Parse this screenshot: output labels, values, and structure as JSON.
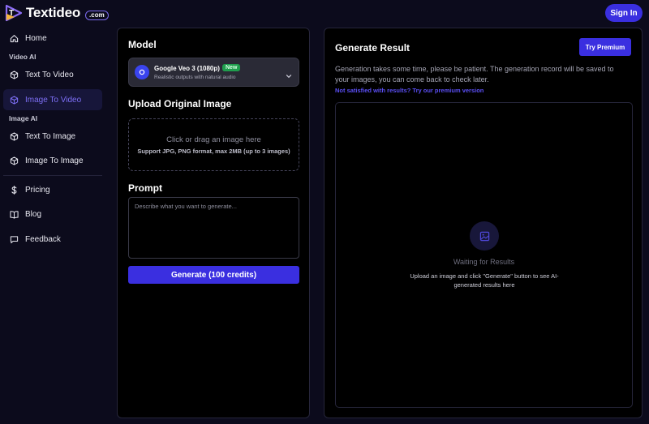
{
  "brand": {
    "name": "Textideo",
    "suffix": ".com"
  },
  "header": {
    "signin_label": "Sign In"
  },
  "sidebar": {
    "home": "Home",
    "video_section": "Video AI",
    "text_to_video": "Text To Video",
    "image_to_video": "Image To Video",
    "image_section": "Image AI",
    "text_to_image": "Text To Image",
    "image_to_image": "Image To Image",
    "pricing": "Pricing",
    "blog": "Blog",
    "feedback": "Feedback"
  },
  "left_panel": {
    "model_title": "Model",
    "model_name": "Google Veo 3 (1080p)",
    "model_badge": "New",
    "model_desc": "Realistic outputs with natural audio",
    "upload_title": "Upload Original Image",
    "upload_main": "Click or drag an image here",
    "upload_sub": "Support JPG, PNG format, max 2MB (up to 3 images)",
    "prompt_title": "Prompt",
    "prompt_placeholder": "Describe what you want to generate...",
    "generate_label": "Generate (100 credits)"
  },
  "right_panel": {
    "title": "Generate Result",
    "premium_label": "Try Premium",
    "note": "Generation takes some time, please be patient. The generation record will be saved to your images, you can come back to check later.",
    "premium_link": "Not satisfied with results? Try our premium version",
    "waiting_title": "Waiting for Results",
    "waiting_desc": "Upload an image and click \"Generate\" button to see AI-generated results here"
  },
  "colors": {
    "accent": "#3a2fe0",
    "active_text": "#7d6ff5",
    "background": "#0c0b1c",
    "new_badge": "#1f9d4d"
  }
}
